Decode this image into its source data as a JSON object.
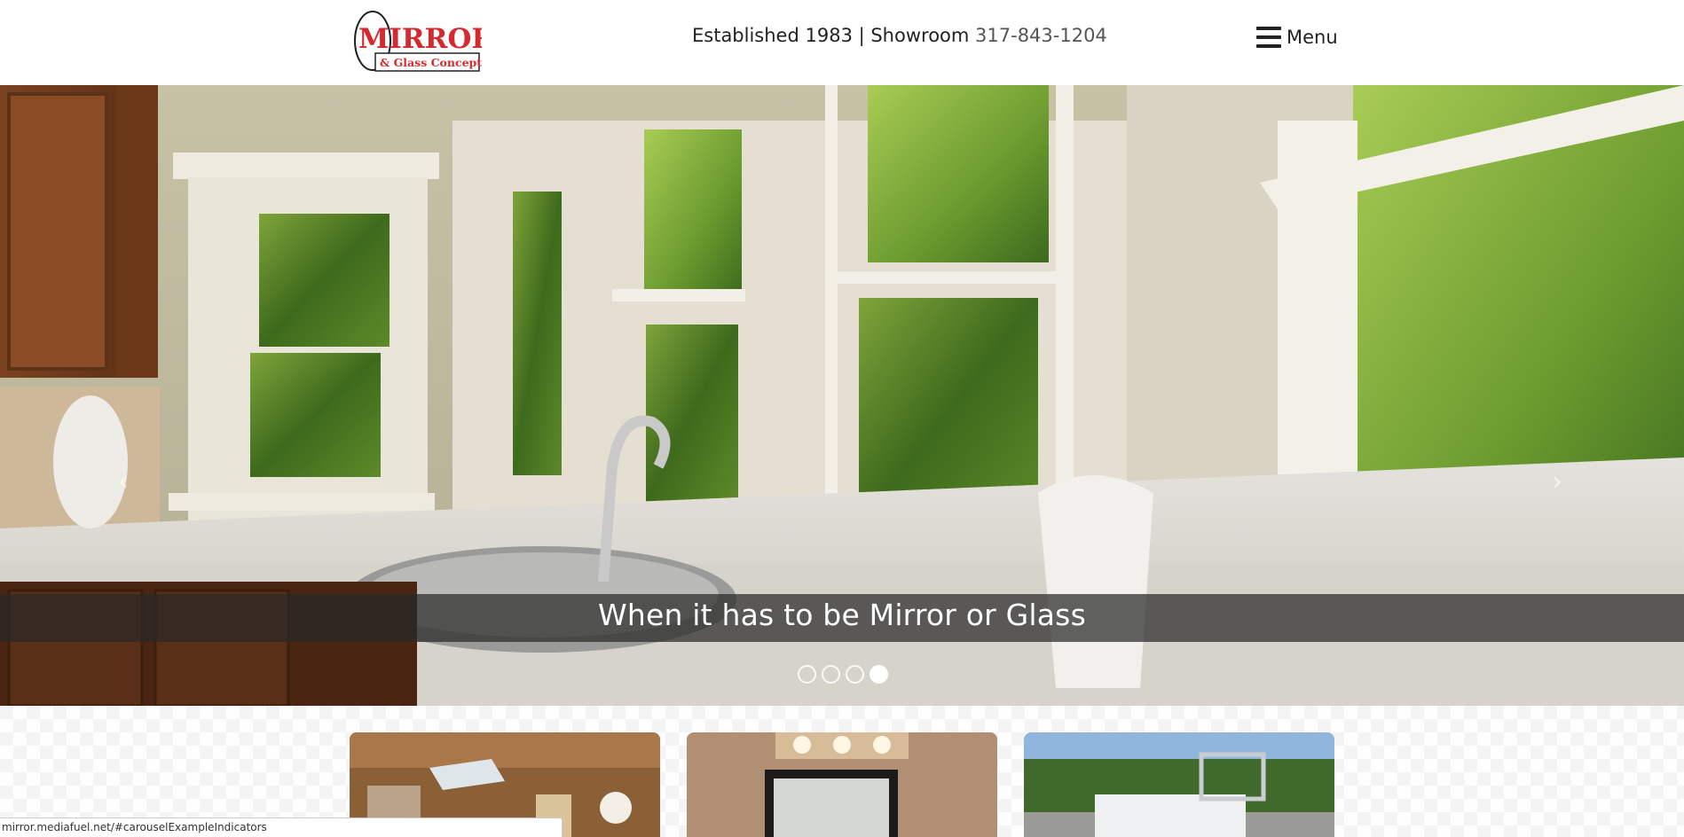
{
  "header": {
    "logo": {
      "title": "MIRROR",
      "subtitle": "& Glass Concepts"
    },
    "tagline": "Established 1983 | Showroom ",
    "phone": "317-843-1204",
    "menu_label": "Menu",
    "menu_icon": "hamburger-icon"
  },
  "hero": {
    "caption": "When it has to be Mirror or Glass",
    "prev_icon": "chevron-left-icon",
    "next_icon": "chevron-right-icon",
    "indicators": {
      "count": 4,
      "active_index": 3
    }
  },
  "cards": [
    {
      "name": "bathroom"
    },
    {
      "name": "vanity-mirror"
    },
    {
      "name": "glass-truck"
    }
  ],
  "statusbar": {
    "url": "mirror.mediafuel.net/#carouselExampleIndicators"
  },
  "colors": {
    "brand_red": "#d42a2f",
    "text": "#222222",
    "caption_band": "#282828"
  }
}
